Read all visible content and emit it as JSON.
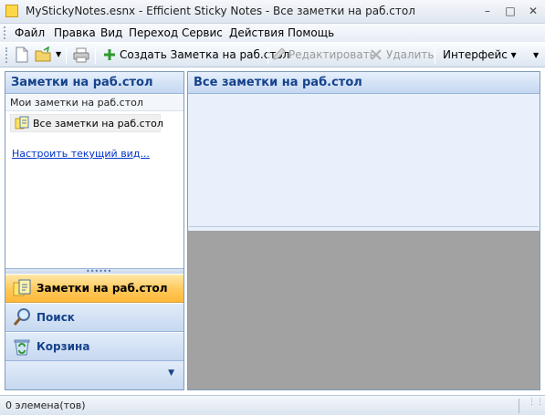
{
  "window": {
    "title": "MyStickyNotes.esnx - Efficient Sticky Notes - Все заметки на раб.стол",
    "minimize_icon": "minimize-icon",
    "maximize_icon": "maximize-icon",
    "close_icon": "close-icon"
  },
  "menu": {
    "items": [
      {
        "label": "Файл"
      },
      {
        "label": "Правка"
      },
      {
        "label": "Вид"
      },
      {
        "label": "Переход"
      },
      {
        "label": "Сервис"
      },
      {
        "label": "Действия"
      },
      {
        "label": "Помощь"
      }
    ]
  },
  "toolbar": {
    "create_label": "Создать Заметка на раб.стол",
    "edit_label": "Редактировать",
    "delete_label": "Удалить",
    "interface_label": "Интерфейс ▾"
  },
  "left": {
    "header": "Заметки на раб.стол",
    "section": "Мои заметки на раб.стол",
    "tree_item": "Все заметки на раб.стол",
    "customize_link": "Настроить текущий вид...",
    "nav": [
      {
        "label": "Заметки на раб.стол",
        "active": true
      },
      {
        "label": "Поиск",
        "active": false
      },
      {
        "label": "Корзина",
        "active": false
      }
    ]
  },
  "right": {
    "header": "Все заметки на раб.стол"
  },
  "status": {
    "text": "0 элемена(тов)"
  },
  "colors": {
    "header_text": "#15428b",
    "active_nav": "#ffc85a",
    "preview_bg": "#a2a2a2",
    "link": "#0033cc"
  }
}
